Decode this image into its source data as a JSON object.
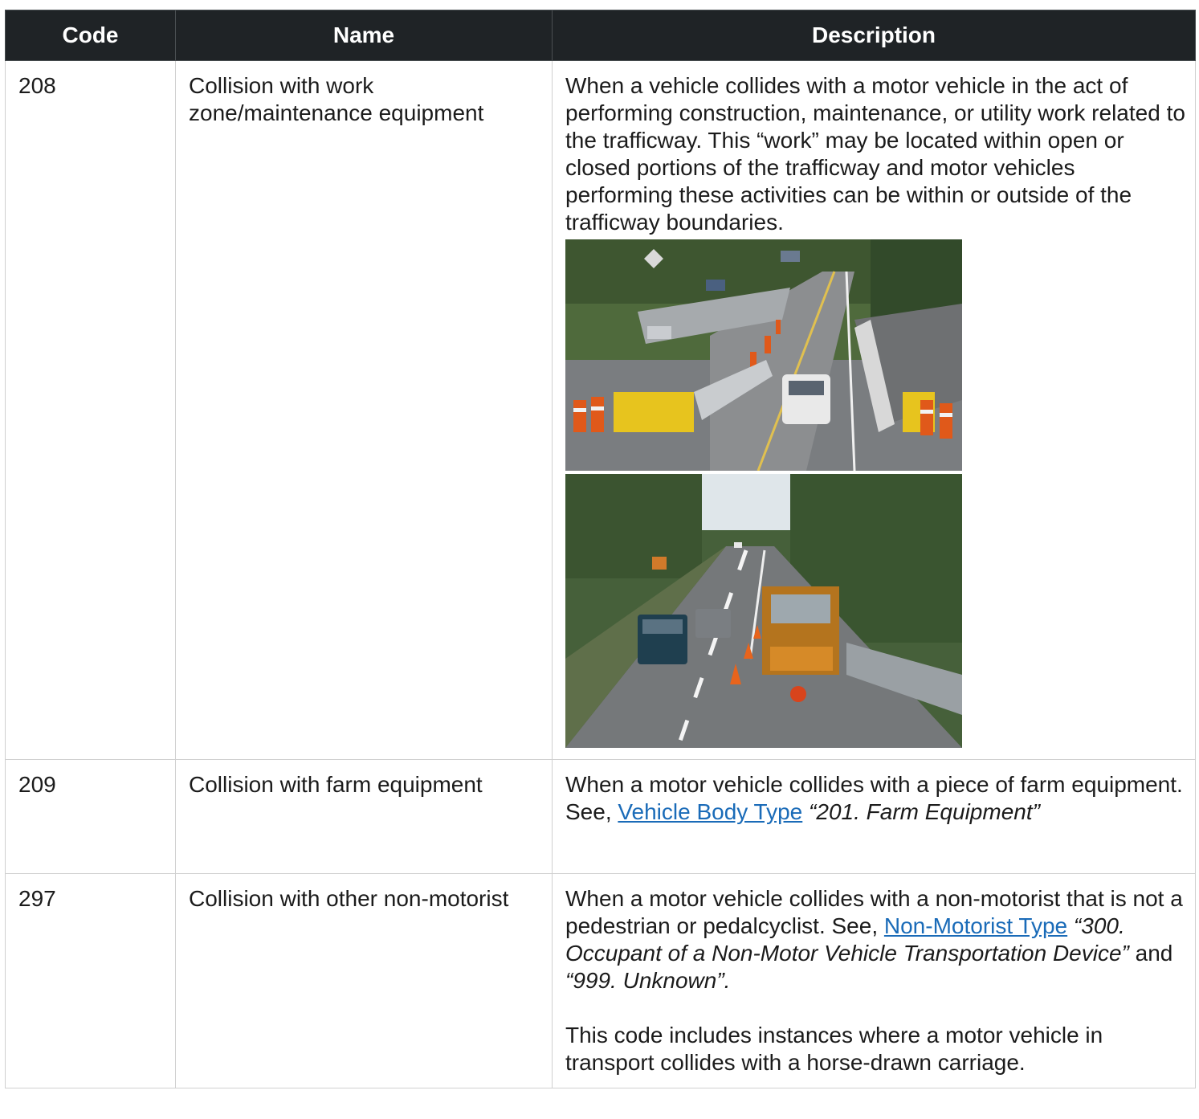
{
  "table": {
    "headers": [
      "Code",
      "Name",
      "Description"
    ],
    "rows": [
      {
        "code": "208",
        "name": "Collision with work zone/maintenance equipment",
        "description": "When a vehicle collides with a motor vehicle in the act of performing construction, maintenance, or utility work related to the trafficway. This “work” may be located within open or closed portions of the trafficway and motor vehicles performing these activities can be within or outside of the trafficway boundaries."
      },
      {
        "code": "209",
        "name": "Collision with farm equipment",
        "desc_pre": "When a motor vehicle collides with a piece of farm equipment. See,",
        "desc_link": "Vehicle Body Type",
        "desc_italic": "“201. Farm Equipment”"
      },
      {
        "code": "297",
        "name": "Collision with other non-motorist",
        "desc_pre": "When a motor vehicle collides with a non-motorist that is not a pedestrian or pedalcyclist. See,",
        "desc_link": "Non-Motorist Type",
        "desc_italic1": "“300. Occupant of a Non-Motor Vehicle Transportation Device”",
        "desc_mid": "and",
        "desc_italic2": "“999. Unknown”.",
        "desc_para2": "This code includes instances where a motor vehicle in transport collides with a horse-drawn carriage."
      }
    ]
  }
}
